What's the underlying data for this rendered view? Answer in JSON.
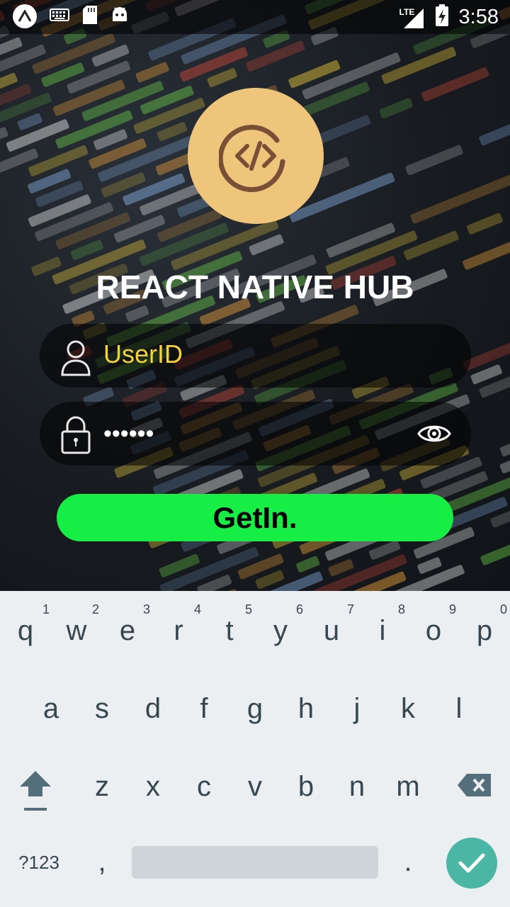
{
  "status_bar": {
    "time": "3:58",
    "network": "LTE",
    "icons": [
      "nova-launcher-icon",
      "keyboard-icon",
      "sd-card-icon",
      "android-icon",
      "signal-icon",
      "battery-charging-icon"
    ]
  },
  "app": {
    "title": "REACT NATIVE HUB",
    "logo_color": "#eec57a",
    "logo_icon": "code-icon"
  },
  "login": {
    "user_placeholder": "UserID",
    "password_masked": "••••••",
    "button_label": "GetIn.",
    "button_color": "#17ee45",
    "placeholder_color": "#f5d33a"
  },
  "keyboard": {
    "row1": [
      "q",
      "w",
      "e",
      "r",
      "t",
      "y",
      "u",
      "i",
      "o",
      "p"
    ],
    "row1_hints": [
      "1",
      "2",
      "3",
      "4",
      "5",
      "6",
      "7",
      "8",
      "9",
      "0"
    ],
    "row2": [
      "a",
      "s",
      "d",
      "f",
      "g",
      "h",
      "j",
      "k",
      "l"
    ],
    "row3": [
      "z",
      "x",
      "c",
      "v",
      "b",
      "n",
      "m"
    ],
    "symbols_label": "?123",
    "comma": ",",
    "period": ".",
    "enter_color": "#4cb6a4"
  }
}
